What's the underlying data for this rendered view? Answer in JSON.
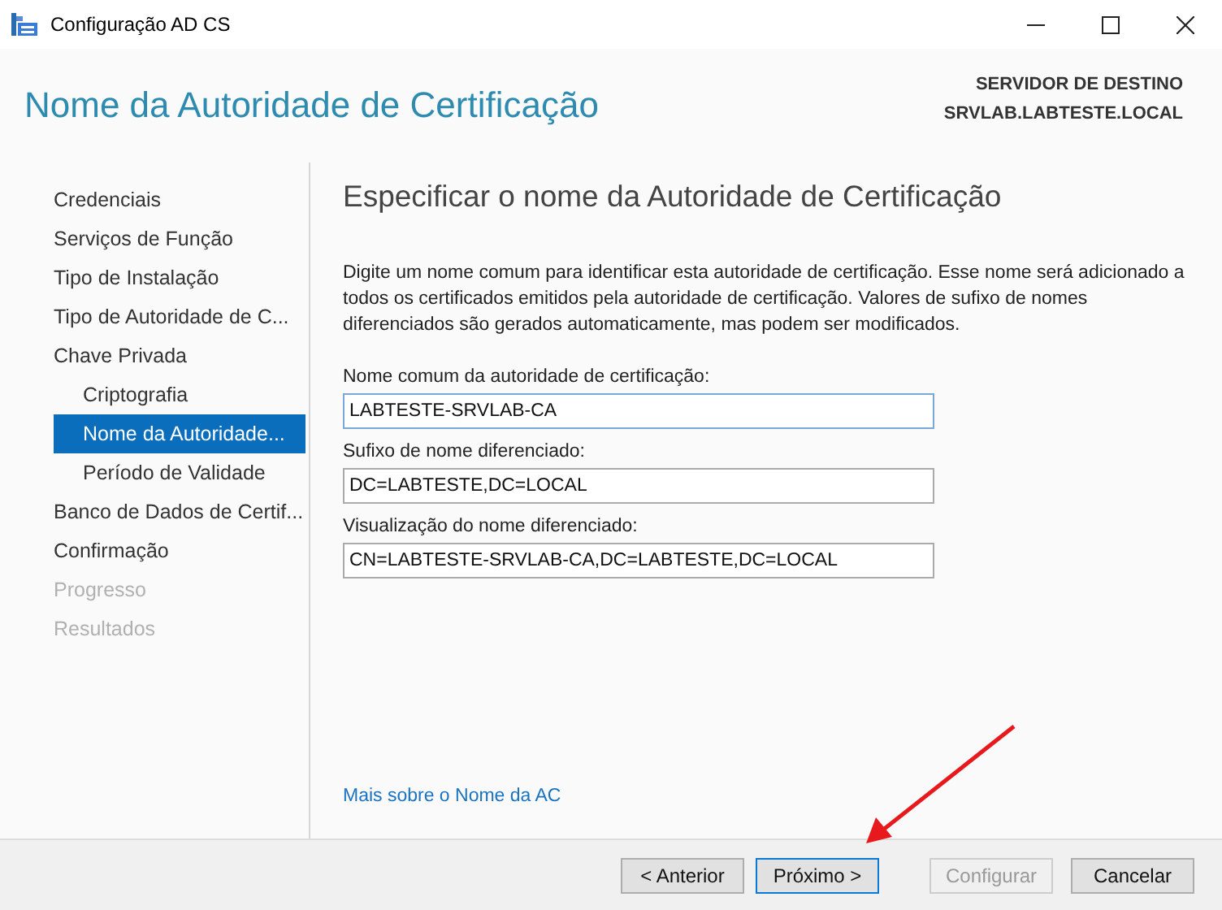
{
  "window": {
    "title": "Configuração AD CS"
  },
  "header": {
    "title": "Nome da Autoridade de Certificação",
    "server_label": "SERVIDOR DE DESTINO",
    "server_name": "SRVLAB.LABTESTE.LOCAL"
  },
  "steps": [
    {
      "label": "Credenciais",
      "selected": false,
      "disabled": false
    },
    {
      "label": "Serviços de Função",
      "selected": false,
      "disabled": false
    },
    {
      "label": "Tipo de Instalação",
      "selected": false,
      "disabled": false
    },
    {
      "label": "Tipo de Autoridade de C...",
      "selected": false,
      "disabled": false
    },
    {
      "label": "Chave Privada",
      "selected": false,
      "disabled": false,
      "children": [
        {
          "label": "Criptografia",
          "selected": false,
          "disabled": false
        },
        {
          "label": "Nome da Autoridade...",
          "selected": true,
          "disabled": false
        },
        {
          "label": "Período de Validade",
          "selected": false,
          "disabled": false
        }
      ]
    },
    {
      "label": "Banco de Dados de Certif...",
      "selected": false,
      "disabled": false
    },
    {
      "label": "Confirmação",
      "selected": false,
      "disabled": false
    },
    {
      "label": "Progresso",
      "selected": false,
      "disabled": true
    },
    {
      "label": "Resultados",
      "selected": false,
      "disabled": true
    }
  ],
  "page": {
    "heading": "Especificar o nome da Autoridade de Certificação",
    "description": "Digite um nome comum para identificar esta autoridade de certificação. Esse nome será adicionado a todos os certificados emitidos pela autoridade de certificação. Valores de sufixo de nomes diferenciados são gerados automaticamente, mas podem ser modificados.",
    "fields": [
      {
        "label": "Nome comum da autoridade de certificação:",
        "value": "LABTESTE-SRVLAB-CA",
        "focused": true
      },
      {
        "label": "Sufixo de nome diferenciado:",
        "value": "DC=LABTESTE,DC=LOCAL",
        "focused": false
      },
      {
        "label": "Visualização do nome diferenciado:",
        "value": "CN=LABTESTE-SRVLAB-CA,DC=LABTESTE,DC=LOCAL",
        "focused": false
      }
    ],
    "link": "Mais sobre o Nome da AC"
  },
  "buttons": [
    {
      "label": "< Anterior",
      "disabled": false,
      "focused": false
    },
    {
      "label": "Próximo >",
      "disabled": false,
      "focused": true
    },
    {
      "label": "Configurar",
      "disabled": true,
      "focused": false
    },
    {
      "label": "Cancelar",
      "disabled": false,
      "focused": false
    }
  ]
}
